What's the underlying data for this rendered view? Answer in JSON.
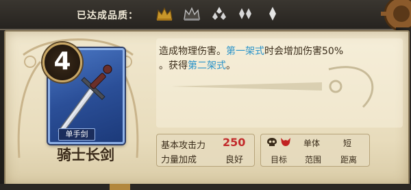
{
  "header": {
    "quality_label": "已达成品质："
  },
  "quality_icons": [
    {
      "icon": "crown-icon",
      "active": true,
      "color": "#c8962a"
    },
    {
      "icon": "crown-icon",
      "active": false,
      "color": "#c9c9c9"
    },
    {
      "icon": "triple-diamond-icon",
      "active": false,
      "color": "#d8d8d8"
    },
    {
      "icon": "double-diamond-icon",
      "active": false,
      "color": "#d8d8d8"
    },
    {
      "icon": "single-diamond-icon",
      "active": false,
      "color": "#d8d8d8"
    }
  ],
  "weapon": {
    "level": "4",
    "type_tag": "单手剑",
    "name": "骑士长剑"
  },
  "description": {
    "part1": "造成物理伤害。",
    "hl1": "第一架式",
    "part2": "时会增加伤害50%",
    "part3": "。获得",
    "hl2": "第二架式",
    "part4": "。"
  },
  "stats": {
    "attack_label": "基本攻击力",
    "attack_value": "250",
    "strength_label": "力量加成",
    "strength_value": "良好"
  },
  "tags": {
    "target_value": "单体",
    "range_value": "短",
    "target_label": "目标",
    "range_label": "范围",
    "distance_label": "距离"
  }
}
